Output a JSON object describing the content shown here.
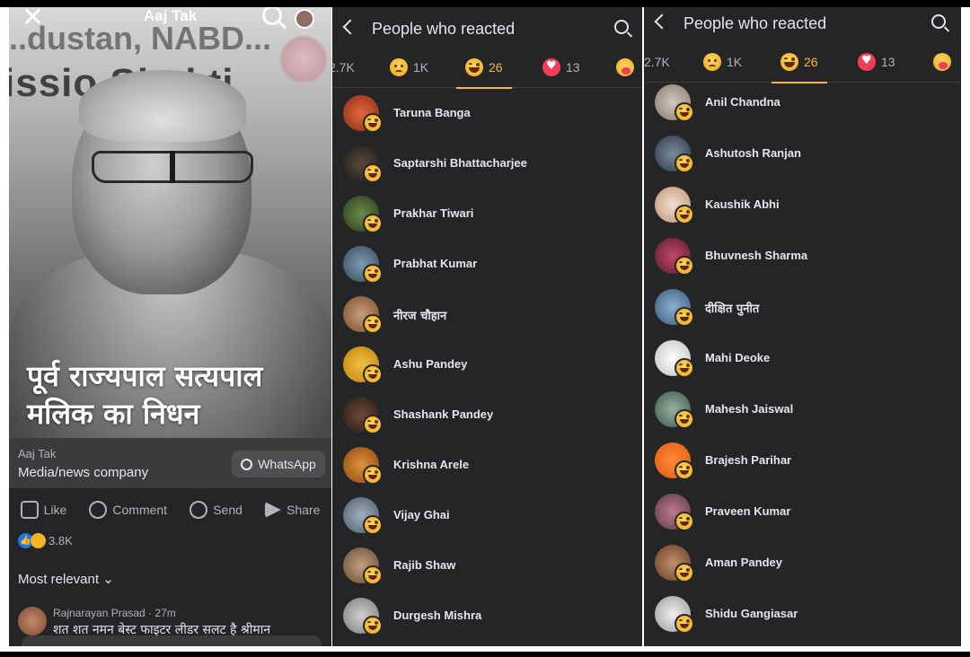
{
  "post": {
    "header_title": "Aaj Tak",
    "photo_bg_text": "issio   Shakti",
    "photo_bg_top": "...dustan, NABD...",
    "headline": "पूर्व राज्यपाल सत्यपाल मलिक का निधन",
    "page_name": "Aaj Tak",
    "page_category": "Media/news company",
    "whatsapp_label": "WhatsApp",
    "actions": [
      "Like",
      "Comment",
      "Send",
      "Share"
    ],
    "reaction_count": "3.8K",
    "sort_label": "Most relevant",
    "comment": {
      "author": "Rajnarayan Prasad · 27m",
      "text": "शत शत नमन बेस्ट फाइटर लीडर सलट है श्रीमान"
    }
  },
  "reactions_panel_left": {
    "title": "People who reacted",
    "tabs": [
      {
        "count": "2.7K",
        "emoji": "like"
      },
      {
        "count": "1K",
        "emoji": "sad"
      },
      {
        "count": "26",
        "emoji": "haha",
        "active": true
      },
      {
        "count": "13",
        "emoji": "love"
      },
      {
        "count": "",
        "emoji": "care"
      }
    ],
    "people": [
      "Taruna Banga",
      "Saptarshi Bhattacharjee",
      "Prakhar Tiwari",
      "Prabhat Kumar",
      "नीरज चौहान",
      "Ashu Pandey",
      "Shashank Pandey",
      "Krishna Arele",
      "Vijay Ghai",
      "Rajib Shaw",
      "Durgesh Mishra"
    ]
  },
  "reactions_panel_right": {
    "title": "People who reacted",
    "tabs": [
      {
        "count": "2.7K",
        "emoji": "like"
      },
      {
        "count": "1K",
        "emoji": "sad"
      },
      {
        "count": "26",
        "emoji": "haha",
        "active": true
      },
      {
        "count": "13",
        "emoji": "love"
      },
      {
        "count": "",
        "emoji": "care"
      }
    ],
    "people": [
      "Anil Chandna",
      "Ashutosh Ranjan",
      "Kaushik Abhi",
      "Bhuvnesh Sharma",
      "दीक्षित पुनीत",
      "Mahi Deoke",
      "Mahesh Jaiswal",
      "Brajesh Parihar",
      "Praveen Kumar",
      "Aman Pandey",
      "Shidu Gangiasar"
    ]
  },
  "colors": {
    "panel_bg": "#242526",
    "active_tab": "#f7b928",
    "text": "#e4e6eb",
    "muted": "#b0b3b8",
    "love": "#f33e58",
    "like": "#1877f2"
  }
}
